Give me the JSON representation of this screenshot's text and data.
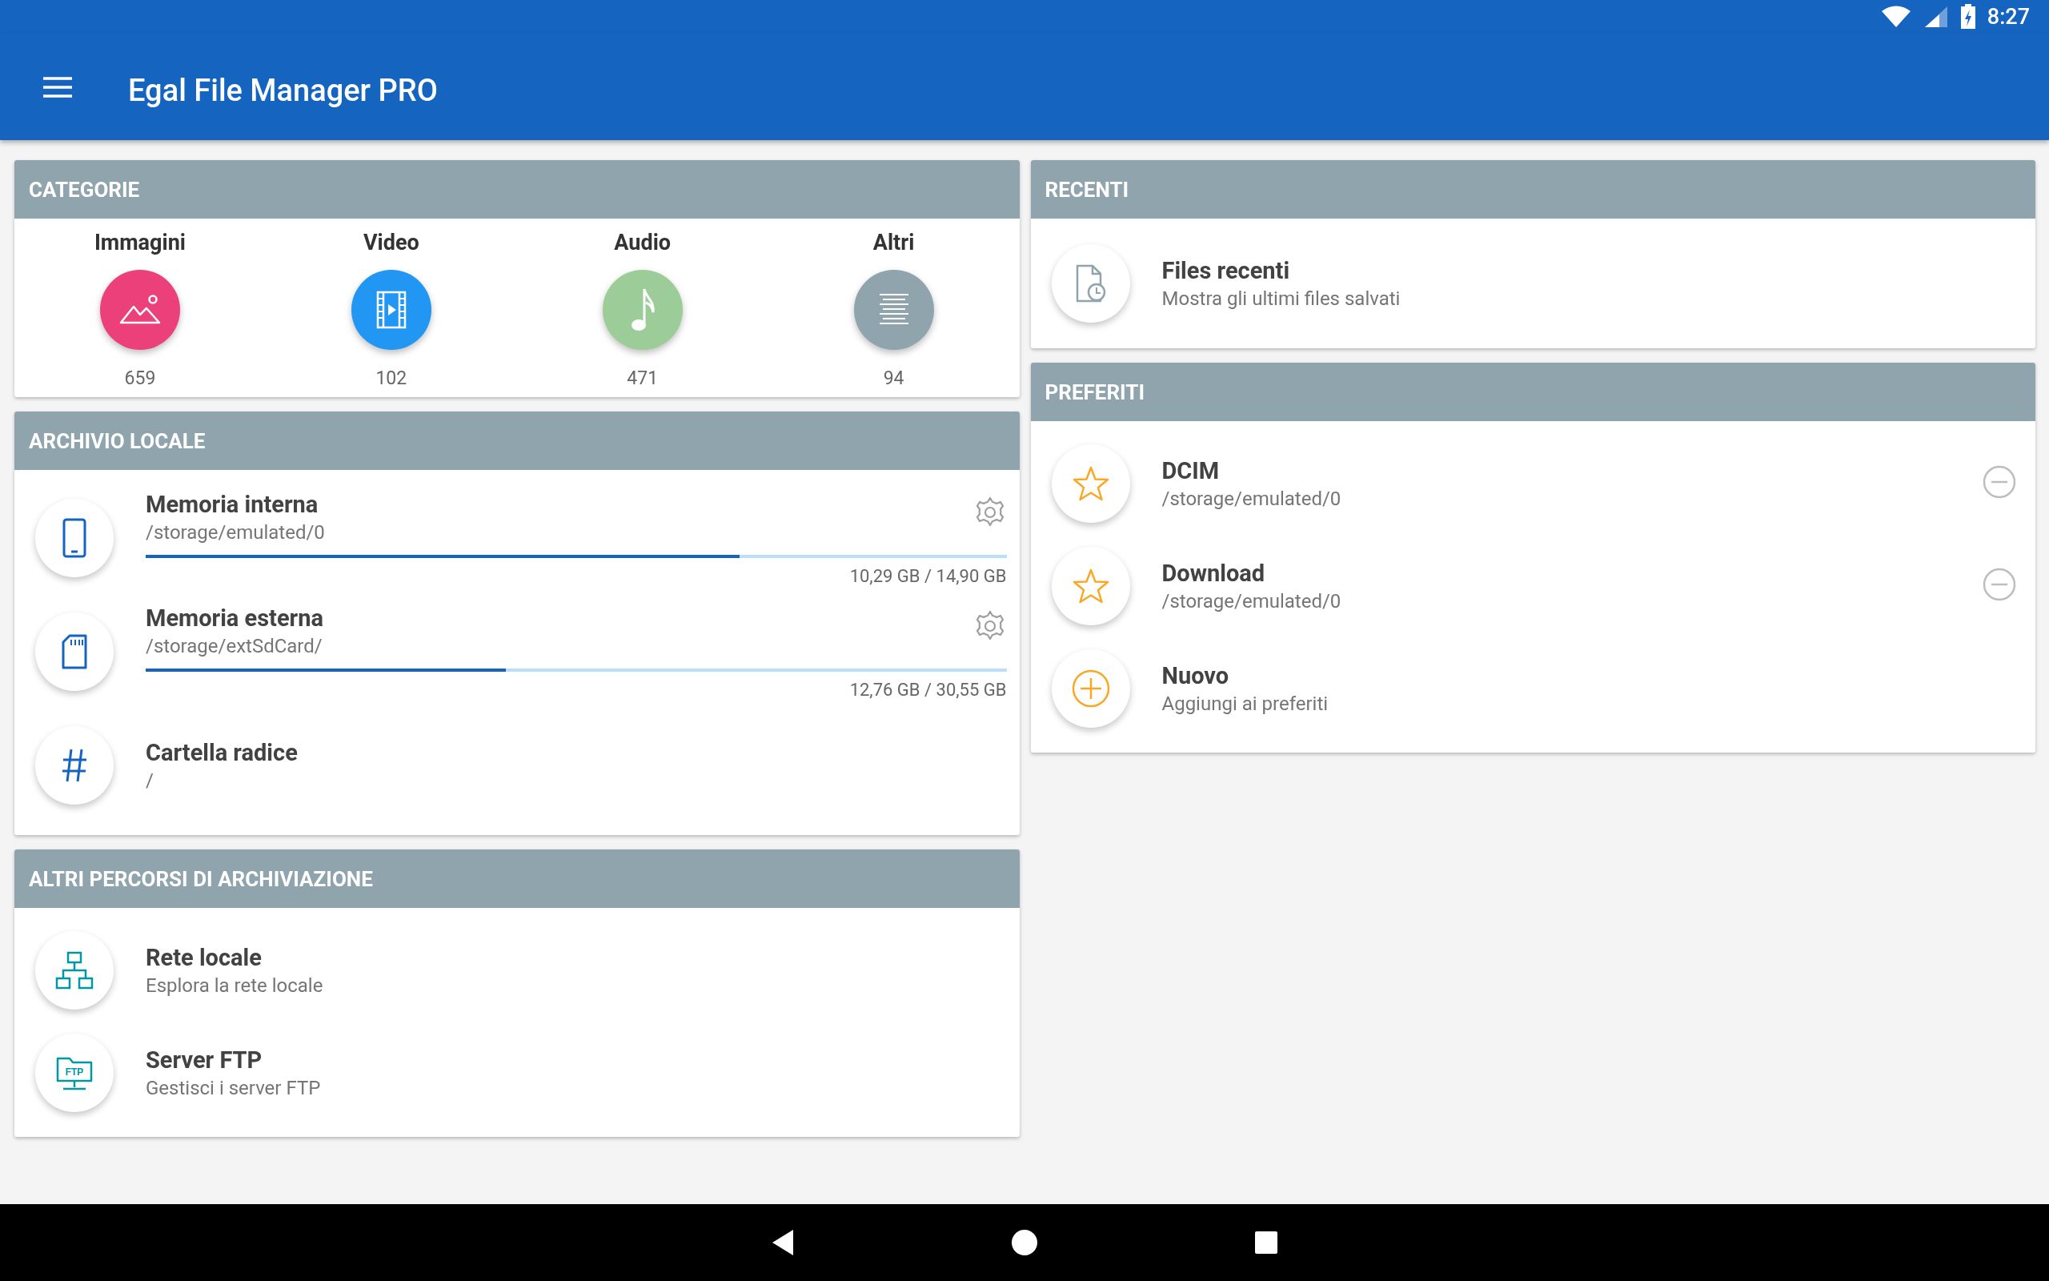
{
  "status_bar": {
    "time": "8:27"
  },
  "app_bar": {
    "title": "Egal File Manager PRO"
  },
  "categories": {
    "header": "CATEGORIE",
    "items": [
      {
        "kind": "images",
        "label": "Immagini",
        "count": "659",
        "color": "#ec407a"
      },
      {
        "kind": "video",
        "label": "Video",
        "count": "102",
        "color": "#2196f3"
      },
      {
        "kind": "audio",
        "label": "Audio",
        "count": "471",
        "color": "#9ccc98"
      },
      {
        "kind": "other",
        "label": "Altri",
        "count": "94",
        "color": "#90a4ae"
      }
    ]
  },
  "local_storage": {
    "header": "ARCHIVIO LOCALE",
    "items": [
      {
        "kind": "phone",
        "title": "Memoria interna",
        "subtitle": "/storage/emulated/0",
        "level": 0.69,
        "usage": "10,29 GB / 14,90 GB"
      },
      {
        "kind": "sdcard",
        "title": "Memoria esterna",
        "subtitle": "/storage/extSdCard/",
        "level": 0.418,
        "usage": "12,76 GB / 30,55 GB"
      },
      {
        "kind": "root",
        "title": "Cartella radice",
        "subtitle": "/"
      }
    ]
  },
  "other_storage": {
    "header": "ALTRI PERCORSI DI ARCHIVIAZIONE",
    "items": [
      {
        "kind": "network",
        "title": "Rete locale",
        "subtitle": "Esplora la rete locale"
      },
      {
        "kind": "ftp",
        "title": "Server FTP",
        "subtitle": "Gestisci i server FTP",
        "icon_label": "FTP"
      }
    ]
  },
  "recent": {
    "header": "RECENTI",
    "items": [
      {
        "kind": "recent",
        "title": "Files recenti",
        "subtitle": "Mostra gli ultimi files salvati"
      }
    ]
  },
  "favorites": {
    "header": "PREFERITI",
    "items": [
      {
        "kind": "star",
        "title": "DCIM",
        "subtitle": "/storage/emulated/0"
      },
      {
        "kind": "star",
        "title": "Download",
        "subtitle": "/storage/emulated/0"
      },
      {
        "kind": "add",
        "title": "Nuovo",
        "subtitle": "Aggiungi ai preferiti"
      }
    ]
  }
}
